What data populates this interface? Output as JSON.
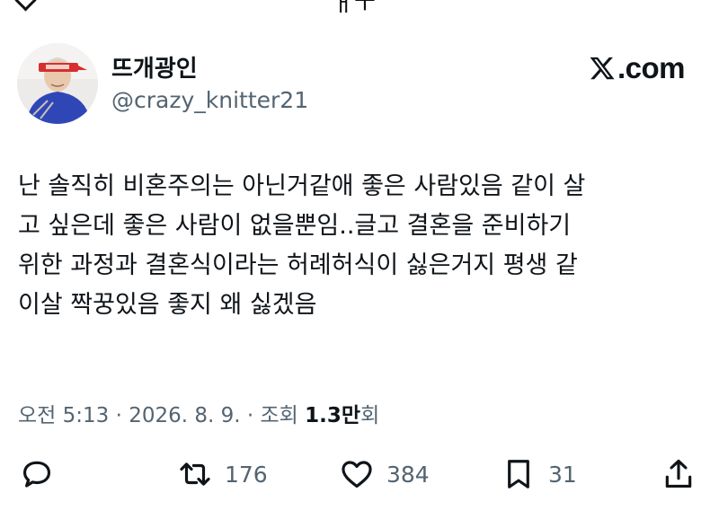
{
  "header": {
    "top_fragment": "ㅐㅜ"
  },
  "author": {
    "display_name": "뜨개광인",
    "handle": "@crazy_knitter21",
    "avatar_icon": "avatar-photo"
  },
  "brand": {
    "logo_icon": "x-logo-icon",
    "domain_text": ".com"
  },
  "tweet": {
    "lines": [
      "난 솔직히 비혼주의는 아닌거같애 좋은 사람있음 같이 살",
      "고 싶은데 좋은 사람이 없을뿐임..글고 결혼을 준비하기",
      "위한 과정과 결혼식이라는 허례허식이 싫은거지 평생 같",
      "이살 짝꿍있음 좋지 왜 싫겠음"
    ]
  },
  "meta": {
    "time": "오전 5:13",
    "sep1": " · ",
    "date": "2026. 8. 9.",
    "sep2": " · ",
    "views_label": "조회 ",
    "views_count": "1.3만",
    "views_suffix": "회"
  },
  "actions": [
    {
      "icon": "reply-icon",
      "count": ""
    },
    {
      "icon": "retweet-icon",
      "count": "176"
    },
    {
      "icon": "heart-icon",
      "count": "384"
    },
    {
      "icon": "bookmark-icon",
      "count": "31"
    },
    {
      "icon": "share-icon",
      "count": ""
    }
  ],
  "colors": {
    "text": "#0f1419",
    "secondary": "#536471",
    "headband": "#d62f2f",
    "sweater": "#2f47b6"
  }
}
